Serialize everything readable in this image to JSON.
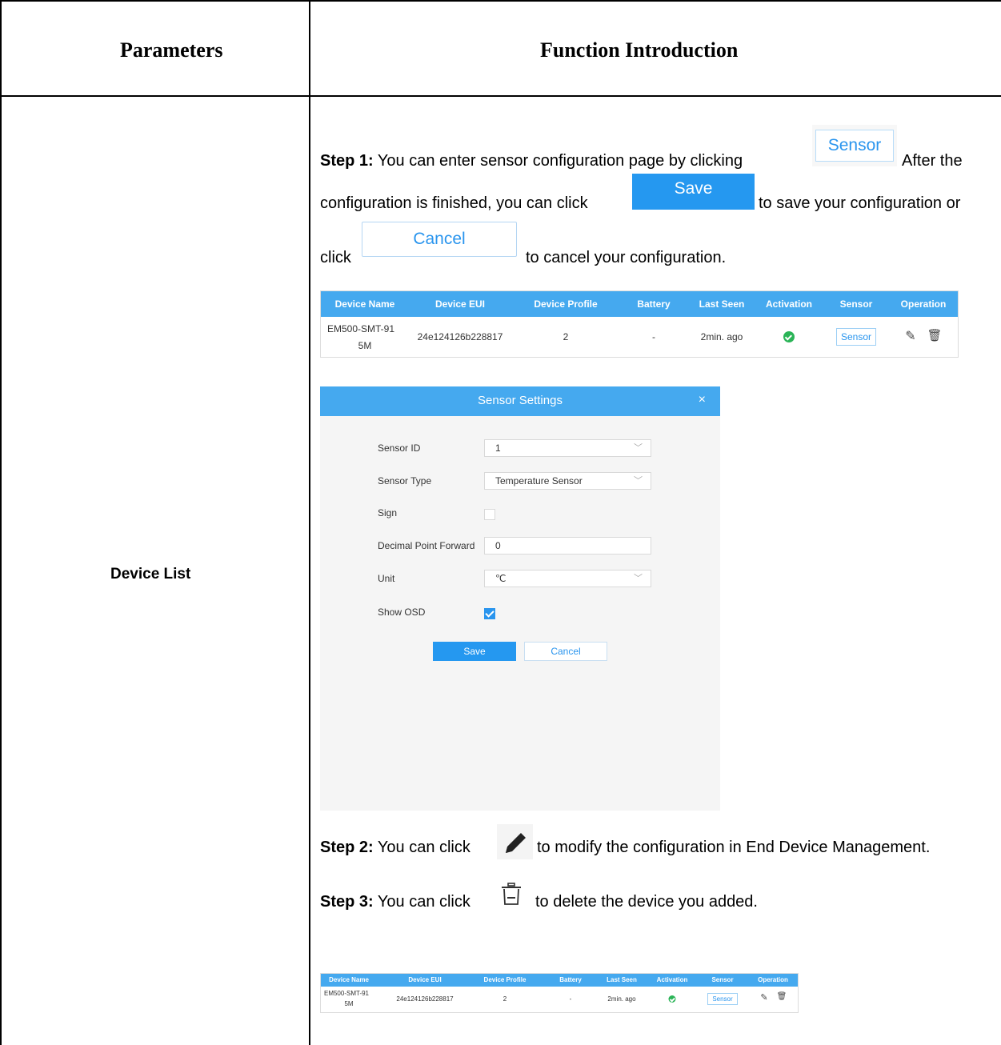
{
  "table": {
    "header_left": "Parameters",
    "header_right": "Function Introduction",
    "row_label": "Device List"
  },
  "step1": {
    "label": "Step 1:",
    "text_a": " You can enter sensor configuration page by clicking",
    "text_b": "After the",
    "text_c": "configuration is finished, you can click",
    "text_d": "to save your configuration or",
    "text_e": "click",
    "text_f": "to cancel your configuration.",
    "sensor_button": "Sensor",
    "save_button": "Save",
    "cancel_button": "Cancel"
  },
  "device_table": {
    "columns": [
      "Device Name",
      "Device EUI",
      "Device Profile",
      "Battery",
      "Last Seen",
      "Activation",
      "Sensor",
      "Operation"
    ],
    "row": {
      "name_line1": "EM500-SMT-91",
      "name_line2": "5M",
      "eui": "24e124126b228817",
      "profile": "2",
      "battery": "-",
      "last_seen": "2min. ago",
      "activation": "active",
      "sensor_button": "Sensor",
      "edit_icon": "pencil-icon",
      "delete_icon": "trash-icon"
    }
  },
  "dialog": {
    "title": "Sensor Settings",
    "close": "×",
    "fields": {
      "sensor_id_label": "Sensor ID",
      "sensor_id_value": "1",
      "sensor_type_label": "Sensor Type",
      "sensor_type_value": "Temperature Sensor",
      "sign_label": "Sign",
      "sign_checked": false,
      "decimal_label": "Decimal Point Forward",
      "decimal_value": "0",
      "unit_label": "Unit",
      "unit_value": "℃",
      "show_osd_label": "Show OSD",
      "show_osd_checked": true
    },
    "save": "Save",
    "cancel": "Cancel"
  },
  "step2": {
    "label": "Step 2:",
    "text_a": " You can click",
    "text_b": "to modify the configuration in End Device Management."
  },
  "step3": {
    "label": "Step 3:",
    "text_a": " You can click",
    "text_b": "to delete the device you added."
  },
  "colors": {
    "accent": "#45a9ef",
    "button": "#2598f0",
    "success": "#2bb457"
  }
}
